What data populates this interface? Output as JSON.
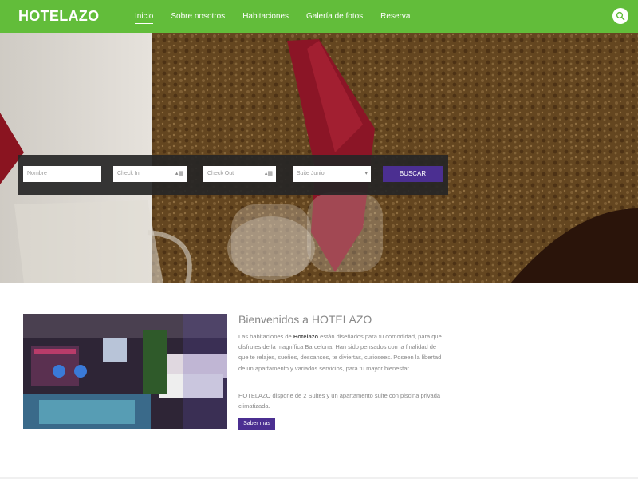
{
  "header": {
    "logo": "HOTELAZO",
    "nav": [
      {
        "label": "Inicio",
        "active": true
      },
      {
        "label": "Sobre nosotros"
      },
      {
        "label": "Habitaciones"
      },
      {
        "label": "Galería de fotos"
      },
      {
        "label": "Reserva"
      }
    ],
    "search_icon": "search-icon"
  },
  "booking": {
    "name_placeholder": "Nombre",
    "checkin_placeholder": "Check In",
    "checkout_placeholder": "Check Out",
    "room_selected": "Suite Junior",
    "search_label": "BUSCAR"
  },
  "welcome": {
    "title": "Bienvenidos a HOTELAZO",
    "p1_before": "Las habitaciones de ",
    "p1_bold": "Hotelazo",
    "p1_after": " están diseñados para tu comodidad, para que disfrutes de la magnífica Barcelona. Han sido pensados con la finalidad de que te relajes, sueñes, descanses, te diviertas, curiosees. Poseen la libertad de un apartamento y variados servicios, para tu mayor bienestar.",
    "p2": "HOTELAZO dispone de 2 Suites y un apartamento suite con piscina privada climatizada.",
    "button": "Saber más"
  },
  "colors": {
    "header_green": "#62bd3a",
    "accent_purple": "#4b2f91"
  }
}
